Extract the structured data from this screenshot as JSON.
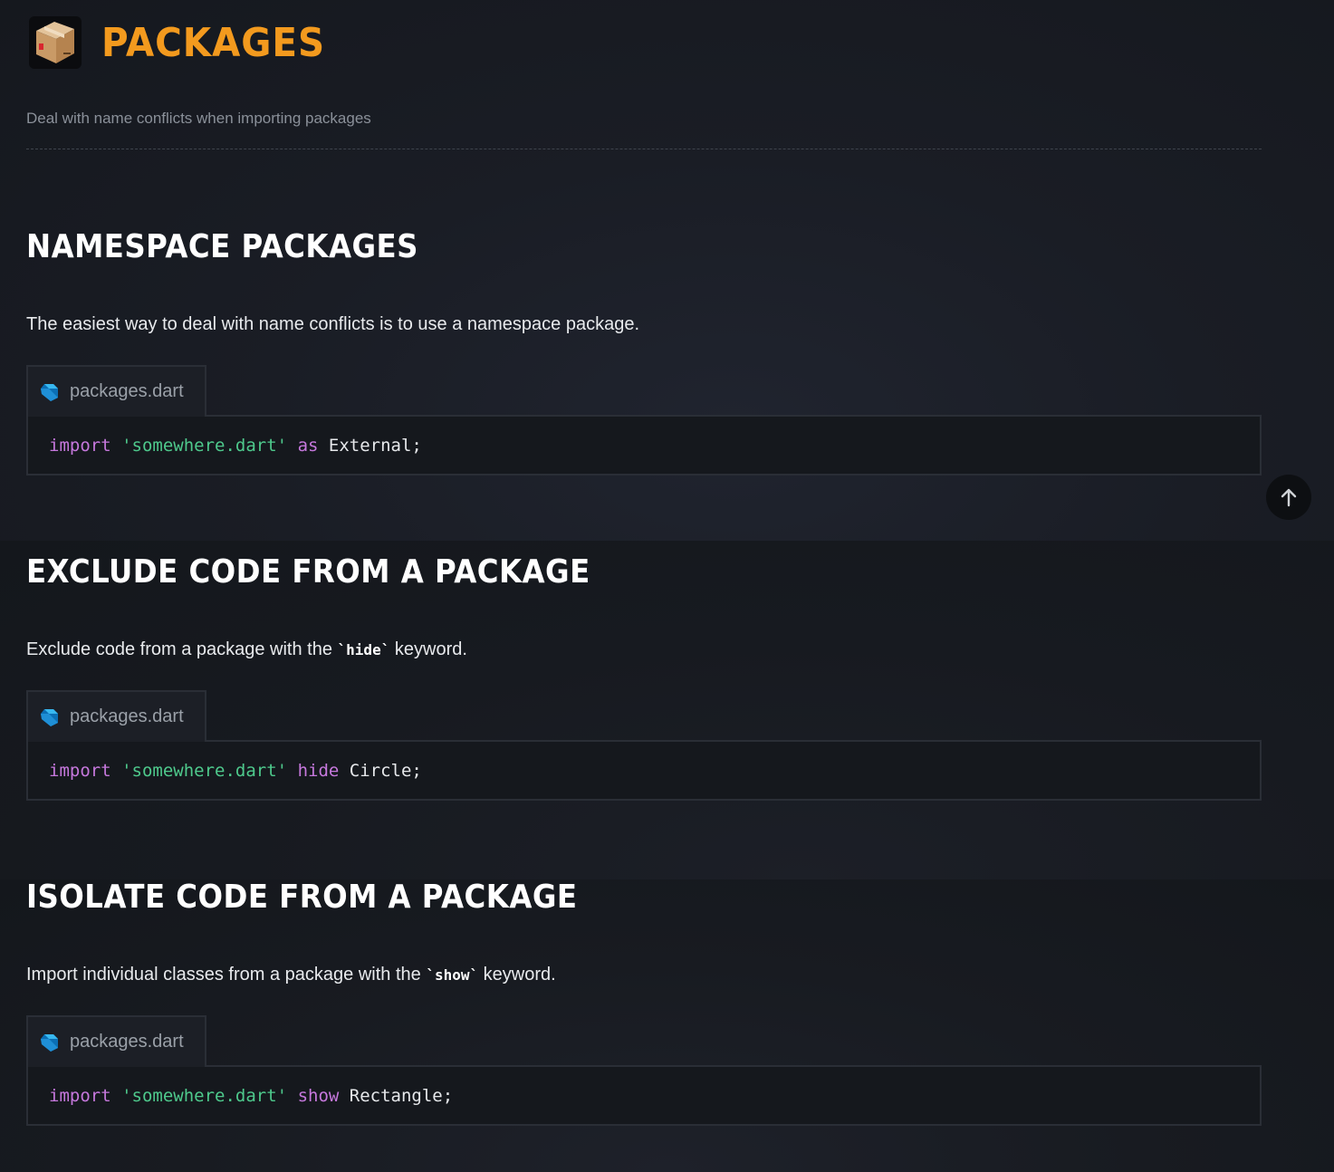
{
  "header": {
    "icon": "package-box-icon",
    "title": "PACKAGES",
    "subtitle": "Deal with name conflicts when importing packages"
  },
  "colors": {
    "title_accent": "#f39a1e",
    "keyword": "#c678dd",
    "string": "#4ec98c"
  },
  "sections": [
    {
      "title": "NAMESPACE PACKAGES",
      "description": "The easiest way to deal with name conflicts is to use a namespace package.",
      "code": {
        "file_icon": "dart-icon",
        "filename": "packages.dart",
        "tokens": [
          {
            "type": "keyword",
            "text": "import"
          },
          {
            "type": "plain",
            "text": " "
          },
          {
            "type": "string",
            "text": "'somewhere.dart'"
          },
          {
            "type": "plain",
            "text": " "
          },
          {
            "type": "keyword",
            "text": "as"
          },
          {
            "type": "plain",
            "text": " External;"
          }
        ]
      }
    },
    {
      "title": "EXCLUDE CODE FROM A PACKAGE",
      "description_before": "Exclude code from a package with the ",
      "description_code": "`hide`",
      "description_after": " keyword.",
      "code": {
        "file_icon": "dart-icon",
        "filename": "packages.dart",
        "tokens": [
          {
            "type": "keyword",
            "text": "import"
          },
          {
            "type": "plain",
            "text": " "
          },
          {
            "type": "string",
            "text": "'somewhere.dart'"
          },
          {
            "type": "plain",
            "text": " "
          },
          {
            "type": "keyword",
            "text": "hide"
          },
          {
            "type": "plain",
            "text": " Circle;"
          }
        ]
      }
    },
    {
      "title": "ISOLATE CODE FROM A PACKAGE",
      "description_before": "Import individual classes from a package with the ",
      "description_code": "`show`",
      "description_after": " keyword.",
      "code": {
        "file_icon": "dart-icon",
        "filename": "packages.dart",
        "tokens": [
          {
            "type": "keyword",
            "text": "import"
          },
          {
            "type": "plain",
            "text": " "
          },
          {
            "type": "string",
            "text": "'somewhere.dart'"
          },
          {
            "type": "plain",
            "text": " "
          },
          {
            "type": "keyword",
            "text": "show"
          },
          {
            "type": "plain",
            "text": " Rectangle;"
          }
        ]
      }
    }
  ],
  "scroll_top_button": {
    "icon": "arrow-up-icon"
  }
}
